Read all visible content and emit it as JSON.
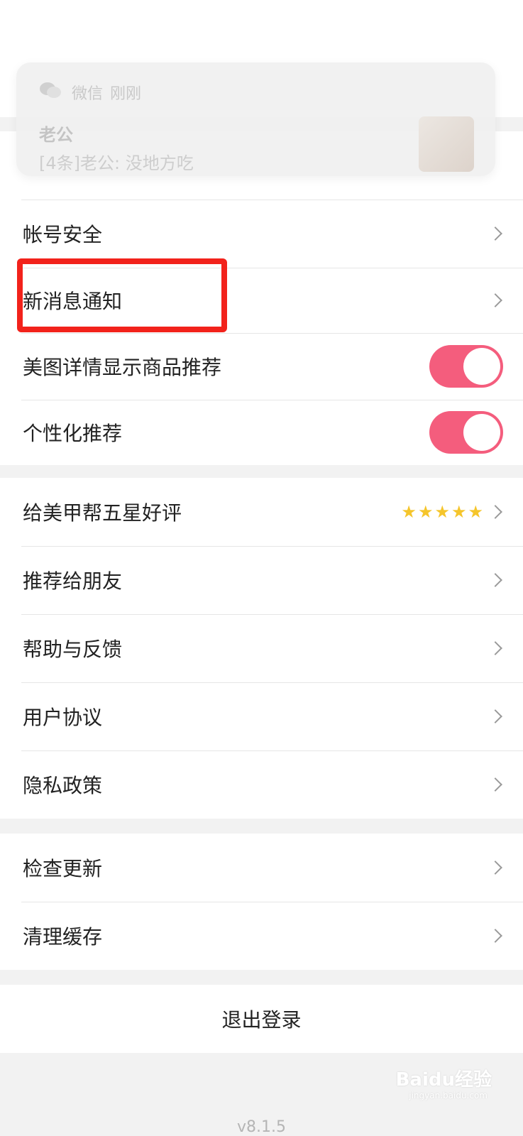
{
  "notification": {
    "app": "微信",
    "time": "刚刚",
    "sender": "老公",
    "body": "[4条]老公: 没地方吃"
  },
  "section1": {
    "items": [
      {
        "label": "帐号安全"
      },
      {
        "label": "新消息通知"
      },
      {
        "label": "美图详情显示商品推荐",
        "toggle": true
      },
      {
        "label": "个性化推荐",
        "toggle": true
      }
    ]
  },
  "section2": {
    "items": [
      {
        "label": "给美甲帮五星好评",
        "stars": 5
      },
      {
        "label": "推荐给朋友"
      },
      {
        "label": "帮助与反馈"
      },
      {
        "label": "用户协议"
      },
      {
        "label": "隐私政策"
      }
    ]
  },
  "section3": {
    "items": [
      {
        "label": "检查更新"
      },
      {
        "label": "清理缓存"
      }
    ]
  },
  "logout": {
    "label": "退出登录"
  },
  "version": {
    "text": "v8.1.5"
  },
  "watermark": {
    "text": "Baidu经验",
    "sub": "jingyan.baidu.com"
  },
  "colors": {
    "toggle_on": "#f45d7d",
    "star": "#f5c52b",
    "highlight": "#f2221b"
  }
}
